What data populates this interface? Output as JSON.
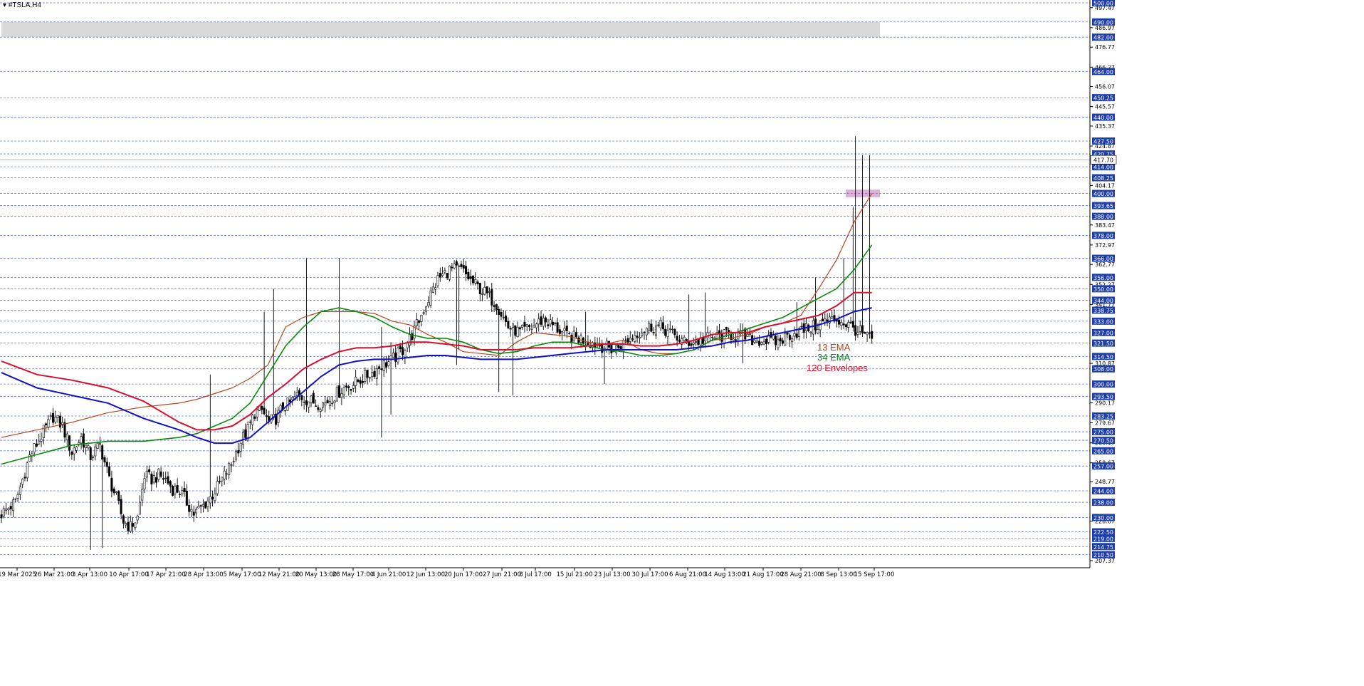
{
  "window": {
    "symbol_title": "#TSLA,H4"
  },
  "colors": {
    "background": "#ffffff",
    "grid": "#6a7dd6",
    "axis_badge": "#1e3ea8",
    "candle": "#000000",
    "ema13": "#b5451b",
    "ema34": "#0a8a0a",
    "env_upper": "#d6102f",
    "env_lower": "#1010c8",
    "resistance_zone": "#d9d9d9",
    "support_zone": "#d9b3d9",
    "current_price_badge": "#ffffff"
  },
  "legend": {
    "ema13": "13 EMA",
    "ema34": "34 EMA",
    "envelopes": "120 Envelopes"
  },
  "chart_data": {
    "type": "candlestick",
    "title": "#TSLA,H4",
    "ylim": [
      207.37,
      500.0
    ],
    "current_price": "417.70",
    "x_ticks": [
      "19 Mar 2025",
      "26 Mar 21:00",
      "3 Apr 13:00",
      "10 Apr 17:00",
      "17 Apr 21:00",
      "28 Apr 13:00",
      "5 May 17:00",
      "12 May 21:00",
      "20 May 13:00",
      "28 May 17:00",
      "4 Jun 21:00",
      "12 Jun 13:00",
      "20 Jun 17:00",
      "27 Jun 21:00",
      "8 Jul 17:00",
      "15 Jul 21:00",
      "23 Jul 13:00",
      "30 Jul 17:00",
      "6 Aug 21:00",
      "14 Aug 13:00",
      "21 Aug 17:00",
      "28 Aug 21:00",
      "8 Sep 13:00",
      "15 Sep 17:00"
    ],
    "level_lines": [
      "500.00",
      "490.00",
      "482.00",
      "464.00",
      "450.25",
      "440.00",
      "427.50",
      "420.75",
      "414.00",
      "408.25",
      "400.00",
      "393.65",
      "388.00",
      "378.00",
      "366.00",
      "356.00",
      "350.00",
      "344.00",
      "338.75",
      "333.00",
      "327.00",
      "321.50",
      "314.50",
      "308.00",
      "300.00",
      "293.50",
      "283.25",
      "275.00",
      "270.50",
      "265.00",
      "257.00",
      "244.00",
      "238.00",
      "230.00",
      "222.50",
      "219.00",
      "214.75",
      "210.50"
    ],
    "scale_labels": [
      "497.47",
      "486.97",
      "476.77",
      "466.27",
      "456.07",
      "445.57",
      "435.37",
      "424.87",
      "404.17",
      "383.47",
      "372.97",
      "362.77",
      "352.27",
      "341.77",
      "310.87",
      "290.17",
      "279.67",
      "269.17",
      "258.67",
      "248.77",
      "228.07",
      "207.37"
    ],
    "zones": [
      {
        "name": "resistance",
        "from": 482.0,
        "to": 490.0
      },
      {
        "name": "support",
        "from": 398.0,
        "to": 402.0
      }
    ],
    "close_path": [
      [
        0,
        232
      ],
      [
        6,
        238
      ],
      [
        12,
        262
      ],
      [
        18,
        275
      ],
      [
        22,
        283
      ],
      [
        26,
        278
      ],
      [
        30,
        264
      ],
      [
        34,
        272
      ],
      [
        38,
        262
      ],
      [
        42,
        268
      ],
      [
        46,
        250
      ],
      [
        49,
        240
      ],
      [
        52,
        228
      ],
      [
        55,
        225
      ],
      [
        58,
        230
      ],
      [
        61,
        252
      ],
      [
        64,
        250
      ],
      [
        67,
        252
      ],
      [
        70,
        250
      ],
      [
        73,
        245
      ],
      [
        76,
        244
      ],
      [
        79,
        238
      ],
      [
        82,
        232
      ],
      [
        86,
        236
      ],
      [
        90,
        242
      ],
      [
        94,
        250
      ],
      [
        98,
        258
      ],
      [
        102,
        270
      ],
      [
        105,
        276
      ],
      [
        108,
        285
      ],
      [
        111,
        286
      ],
      [
        114,
        280
      ],
      [
        117,
        282
      ],
      [
        120,
        288
      ],
      [
        123,
        290
      ],
      [
        126,
        294
      ],
      [
        130,
        292
      ],
      [
        134,
        290
      ],
      [
        138,
        290
      ],
      [
        142,
        294
      ],
      [
        146,
        298
      ],
      [
        150,
        300
      ],
      [
        154,
        303
      ],
      [
        158,
        306
      ],
      [
        162,
        310
      ],
      [
        166,
        312
      ],
      [
        171,
        318
      ],
      [
        176,
        328
      ],
      [
        181,
        342
      ],
      [
        186,
        355
      ],
      [
        191,
        360
      ],
      [
        196,
        360
      ],
      [
        201,
        353
      ],
      [
        206,
        348
      ],
      [
        211,
        342
      ],
      [
        216,
        330
      ],
      [
        221,
        327
      ],
      [
        226,
        330
      ],
      [
        231,
        334
      ],
      [
        236,
        330
      ],
      [
        241,
        325
      ],
      [
        246,
        324
      ],
      [
        251,
        322
      ],
      [
        256,
        320
      ],
      [
        261,
        318
      ],
      [
        266,
        322
      ],
      [
        271,
        327
      ],
      [
        276,
        330
      ],
      [
        281,
        330
      ],
      [
        286,
        326
      ],
      [
        291,
        322
      ],
      [
        296,
        322
      ],
      [
        301,
        324
      ],
      [
        306,
        325
      ],
      [
        311,
        326
      ],
      [
        316,
        325
      ],
      [
        321,
        323
      ],
      [
        326,
        323
      ],
      [
        331,
        322
      ],
      [
        336,
        326
      ],
      [
        341,
        328
      ],
      [
        346,
        330
      ],
      [
        351,
        333
      ],
      [
        356,
        334
      ],
      [
        361,
        331
      ],
      [
        366,
        327
      ],
      [
        371,
        323
      ]
    ],
    "series": [
      {
        "name": "13 EMA",
        "values": [
          [
            0,
            272
          ],
          [
            2,
            276
          ],
          [
            4,
            280
          ],
          [
            6,
            285
          ],
          [
            8,
            288
          ],
          [
            10,
            290
          ],
          [
            11,
            292
          ],
          [
            12,
            295
          ],
          [
            13,
            298
          ],
          [
            14,
            303
          ],
          [
            15,
            310
          ],
          [
            16,
            330
          ],
          [
            17,
            335
          ],
          [
            18,
            338
          ],
          [
            19,
            338
          ],
          [
            20,
            338
          ],
          [
            21,
            337
          ],
          [
            22,
            333
          ],
          [
            23,
            331
          ],
          [
            24,
            326
          ],
          [
            25,
            322
          ],
          [
            26,
            317
          ],
          [
            27,
            316
          ],
          [
            28,
            315
          ],
          [
            29,
            322
          ],
          [
            30,
            327
          ],
          [
            31,
            326
          ],
          [
            32,
            325
          ],
          [
            33,
            322
          ],
          [
            34,
            321
          ],
          [
            35,
            323
          ],
          [
            36,
            318
          ],
          [
            37,
            316
          ],
          [
            38,
            316
          ],
          [
            39,
            318
          ],
          [
            40,
            323
          ],
          [
            41,
            324
          ],
          [
            42,
            326
          ],
          [
            43,
            330
          ],
          [
            44,
            332
          ],
          [
            45,
            336
          ],
          [
            46,
            350
          ],
          [
            47,
            365
          ],
          [
            48,
            385
          ],
          [
            49,
            400
          ]
        ]
      },
      {
        "name": "34 EMA",
        "values": [
          [
            0,
            258
          ],
          [
            2,
            263
          ],
          [
            4,
            268
          ],
          [
            6,
            270
          ],
          [
            8,
            270
          ],
          [
            10,
            272
          ],
          [
            11,
            274
          ],
          [
            12,
            278
          ],
          [
            13,
            282
          ],
          [
            14,
            290
          ],
          [
            15,
            305
          ],
          [
            16,
            320
          ],
          [
            17,
            330
          ],
          [
            18,
            338
          ],
          [
            19,
            340
          ],
          [
            20,
            338
          ],
          [
            21,
            335
          ],
          [
            22,
            330
          ],
          [
            23,
            326
          ],
          [
            24,
            324
          ],
          [
            25,
            324
          ],
          [
            26,
            322
          ],
          [
            27,
            318
          ],
          [
            28,
            316
          ],
          [
            29,
            317
          ],
          [
            30,
            320
          ],
          [
            31,
            322
          ],
          [
            32,
            322
          ],
          [
            33,
            320
          ],
          [
            34,
            318
          ],
          [
            35,
            317
          ],
          [
            36,
            315
          ],
          [
            37,
            315
          ],
          [
            38,
            316
          ],
          [
            39,
            318
          ],
          [
            40,
            323
          ],
          [
            41,
            326
          ],
          [
            42,
            329
          ],
          [
            43,
            332
          ],
          [
            44,
            335
          ],
          [
            45,
            340
          ],
          [
            46,
            345
          ],
          [
            47,
            350
          ],
          [
            48,
            360
          ],
          [
            49,
            373
          ]
        ]
      },
      {
        "name": "120 Envelopes upper",
        "values": [
          [
            0,
            312
          ],
          [
            2,
            305
          ],
          [
            4,
            302
          ],
          [
            6,
            298
          ],
          [
            8,
            291
          ],
          [
            10,
            280
          ],
          [
            11,
            276
          ],
          [
            12,
            276
          ],
          [
            13,
            278
          ],
          [
            14,
            284
          ],
          [
            15,
            293
          ],
          [
            16,
            300
          ],
          [
            17,
            308
          ],
          [
            18,
            313
          ],
          [
            19,
            317
          ],
          [
            20,
            319
          ],
          [
            21,
            319
          ],
          [
            22,
            320
          ],
          [
            23,
            322
          ],
          [
            24,
            322
          ],
          [
            25,
            321
          ],
          [
            26,
            320
          ],
          [
            27,
            318
          ],
          [
            28,
            318
          ],
          [
            29,
            318
          ],
          [
            30,
            319
          ],
          [
            31,
            319
          ],
          [
            32,
            319
          ],
          [
            33,
            320
          ],
          [
            34,
            321
          ],
          [
            35,
            321
          ],
          [
            36,
            320
          ],
          [
            37,
            320
          ],
          [
            38,
            321
          ],
          [
            39,
            323
          ],
          [
            40,
            326
          ],
          [
            41,
            327
          ],
          [
            42,
            327
          ],
          [
            43,
            330
          ],
          [
            44,
            332
          ],
          [
            45,
            334
          ],
          [
            46,
            336
          ],
          [
            47,
            341
          ],
          [
            48,
            348
          ],
          [
            49,
            348
          ]
        ]
      },
      {
        "name": "120 Envelopes lower",
        "values": [
          [
            0,
            306
          ],
          [
            2,
            298
          ],
          [
            4,
            294
          ],
          [
            6,
            290
          ],
          [
            8,
            282
          ],
          [
            10,
            276
          ],
          [
            11,
            272
          ],
          [
            12,
            269
          ],
          [
            13,
            269
          ],
          [
            14,
            272
          ],
          [
            15,
            280
          ],
          [
            16,
            288
          ],
          [
            17,
            296
          ],
          [
            18,
            304
          ],
          [
            19,
            310
          ],
          [
            20,
            312
          ],
          [
            21,
            313
          ],
          [
            22,
            313
          ],
          [
            23,
            314
          ],
          [
            24,
            315
          ],
          [
            25,
            315
          ],
          [
            26,
            314
          ],
          [
            27,
            313
          ],
          [
            28,
            313
          ],
          [
            29,
            313
          ],
          [
            30,
            314
          ],
          [
            31,
            315
          ],
          [
            32,
            316
          ],
          [
            33,
            317
          ],
          [
            34,
            318
          ],
          [
            35,
            318
          ],
          [
            36,
            318
          ],
          [
            37,
            318
          ],
          [
            38,
            318
          ],
          [
            39,
            319
          ],
          [
            40,
            320
          ],
          [
            41,
            322
          ],
          [
            42,
            323
          ],
          [
            43,
            325
          ],
          [
            44,
            327
          ],
          [
            45,
            329
          ],
          [
            46,
            331
          ],
          [
            47,
            334
          ],
          [
            48,
            338
          ],
          [
            49,
            340
          ]
        ]
      }
    ]
  }
}
